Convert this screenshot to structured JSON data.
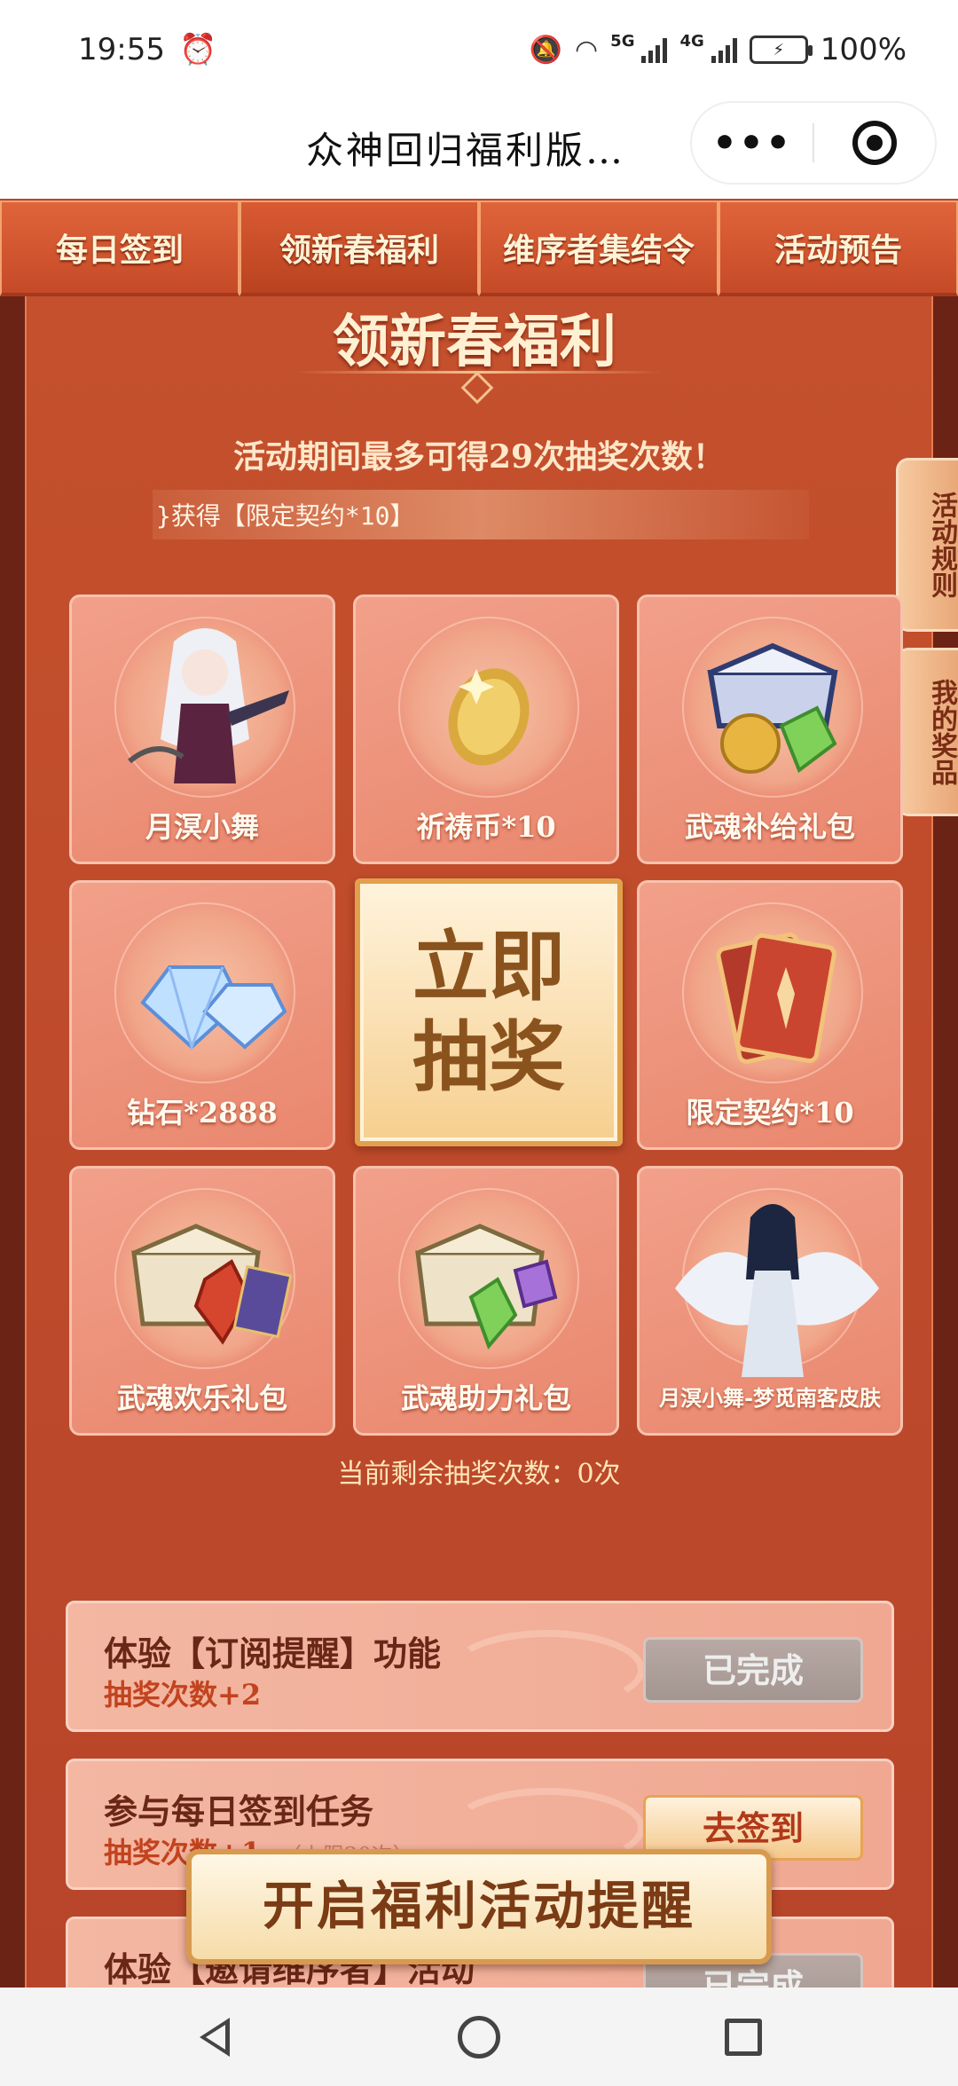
{
  "status_bar": {
    "time": "19:55",
    "net_5g": "5G",
    "net_4g": "4G",
    "battery": "100%"
  },
  "title_bar": {
    "title": "众神回归福利版…",
    "more_label": "•••"
  },
  "tabs": [
    {
      "label": "每日签到"
    },
    {
      "label": "领新春福利"
    },
    {
      "label": "维序者集结令"
    },
    {
      "label": "活动预告"
    }
  ],
  "section": {
    "title": "领新春福利",
    "subtitle": "活动期间最多可得29次抽奖次数！",
    "marquee": "}获得【限定契约*10】"
  },
  "side_buttons": {
    "rules": "活动规则",
    "my_prizes": "我的奖品"
  },
  "prizes": [
    {
      "label": "月溟小舞",
      "icon": "character-portrait"
    },
    {
      "label": "祈祷币*10",
      "icon": "gold-coin"
    },
    {
      "label": "武魂补给礼包",
      "icon": "chest-coins-gems"
    },
    {
      "label": "钻石*2888",
      "icon": "diamond-gems"
    },
    {
      "label": "限定契约*10",
      "icon": "contract-cards"
    },
    {
      "label": "武魂欢乐礼包",
      "icon": "chest-crystal"
    },
    {
      "label": "武魂助力礼包",
      "icon": "chest-gems"
    },
    {
      "label": "月溟小舞-梦觅南客皮肤",
      "icon": "character-skin"
    }
  ],
  "draw_button": {
    "line1": "立即",
    "line2": "抽奖"
  },
  "remaining": "当前剩余抽奖次数：0次",
  "tasks": [
    {
      "title": "体验【订阅提醒】功能",
      "reward": "抽奖次数+2",
      "note": "",
      "button": "已完成"
    },
    {
      "title": "参与每日签到任务",
      "reward": "抽奖次数+1",
      "note": "（上限20次）",
      "button": "去签到"
    },
    {
      "title": "体验【邀请维序者】活动",
      "reward": "",
      "note": "",
      "button": "已完成"
    }
  ],
  "float_button": "开启福利活动提醒",
  "colors": {
    "accent": "#c4502d",
    "tab_text": "#fff3d6",
    "draw_text": "#8a531e"
  }
}
